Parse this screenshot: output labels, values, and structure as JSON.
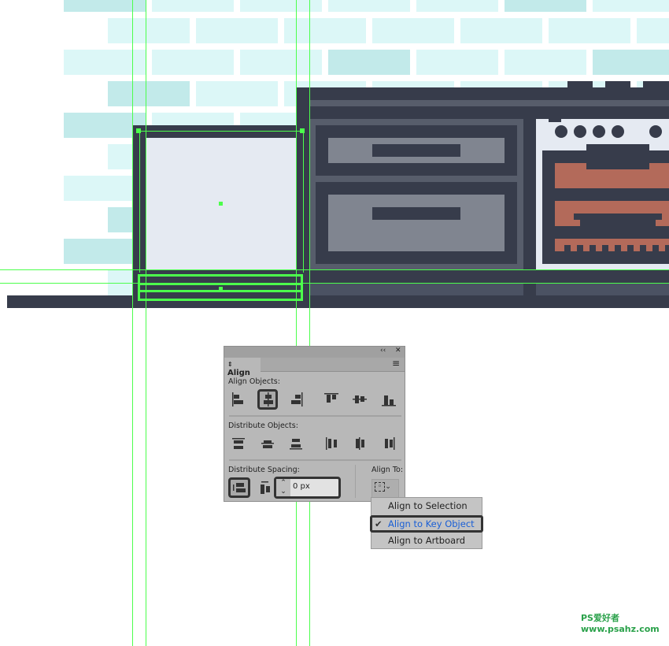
{
  "panel": {
    "title": "Align",
    "align_objects_label": "Align Objects:",
    "distribute_objects_label": "Distribute Objects:",
    "distribute_spacing_label": "Distribute Spacing:",
    "align_to_label": "Align To:",
    "spacing_value": "0 px",
    "collapse_glyph": "‹‹",
    "close_glyph": "✕",
    "menu_glyph": "≡",
    "selected_align_button": "horizontal-align-center"
  },
  "align_to_menu": {
    "items": [
      "Align to Selection",
      "Align to Key Object",
      "Align to Artboard"
    ],
    "checked": "Align to Key Object",
    "check_glyph": "✔"
  },
  "colors": {
    "guide": "#4cff4c",
    "dark": "#373c4b",
    "brick": "#dcf7f7",
    "oven_red": "#b36a5a",
    "menu_active_text": "#1a5fd6"
  },
  "watermark": "PS爱好者 www.psahz.com"
}
